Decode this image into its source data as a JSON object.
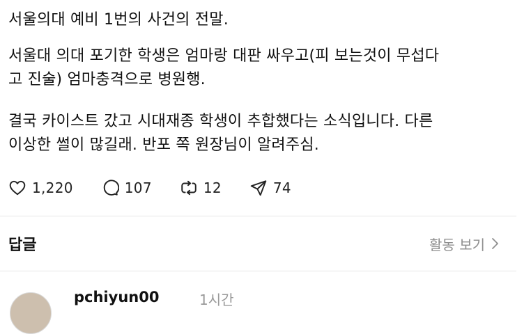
{
  "post": {
    "lines": [
      "서울의대 예비 1번의 사건의 전말.",
      "서울대 의대 포기한 학생은 엄마랑 대판 싸우고(피 보는것이 무섭다\n고 진술) 엄마충격으로 병원행.",
      "결국 카이스트 갔고 시대재종 학생이 추합했다는 소식입니다. 다른\n이상한 썰이 많길래. 반포 쪽 원장님이 알려주심."
    ]
  },
  "actions": {
    "likes": "1,220",
    "comments": "107",
    "reposts": "12",
    "shares": "74"
  },
  "replies": {
    "label": "답글",
    "activity_label": "활동 보기"
  },
  "first_reply": {
    "username": "pchiyun00",
    "time": "1시간"
  }
}
